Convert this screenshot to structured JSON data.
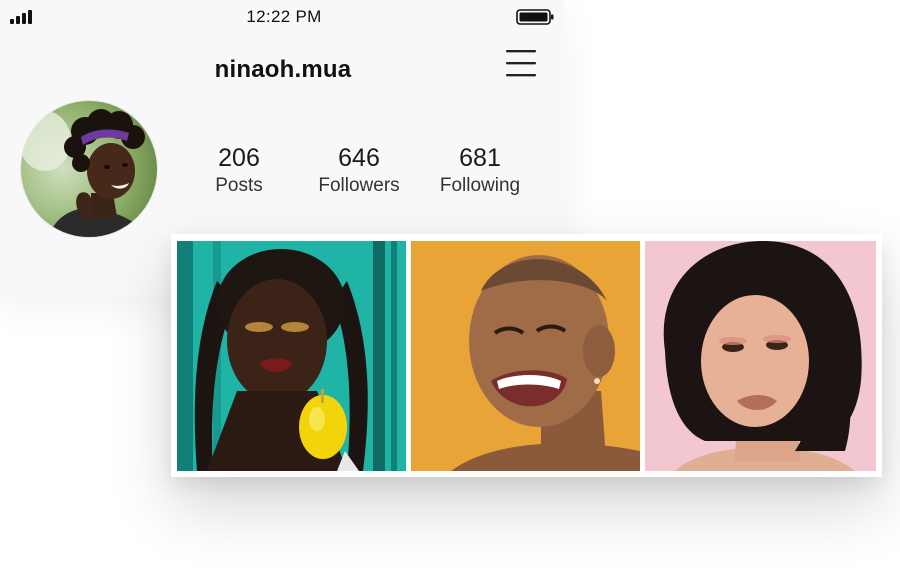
{
  "status_bar": {
    "time": "12:22 PM",
    "signal_icon": "signal-bars-icon",
    "battery_icon": "battery-icon"
  },
  "profile": {
    "username": "ninaoh.mua",
    "menu_icon": "hamburger-menu-icon",
    "avatar_icon": "avatar-photo",
    "stats": {
      "posts": {
        "value": "206",
        "label": "Posts"
      },
      "followers": {
        "value": "646",
        "label": "Followers"
      },
      "following": {
        "value": "681",
        "label": "Following"
      }
    }
  },
  "photos": [
    {
      "name": "photo-woman-teal-wall-lemon",
      "bg": "#1fb4a6"
    },
    {
      "name": "photo-woman-orange-laughing",
      "bg": "#e8a437"
    },
    {
      "name": "photo-woman-pink-bob-hair",
      "bg": "#f2c7cf"
    }
  ],
  "colors": {
    "phone_bg": "#f8f8f8",
    "text": "#111111"
  }
}
